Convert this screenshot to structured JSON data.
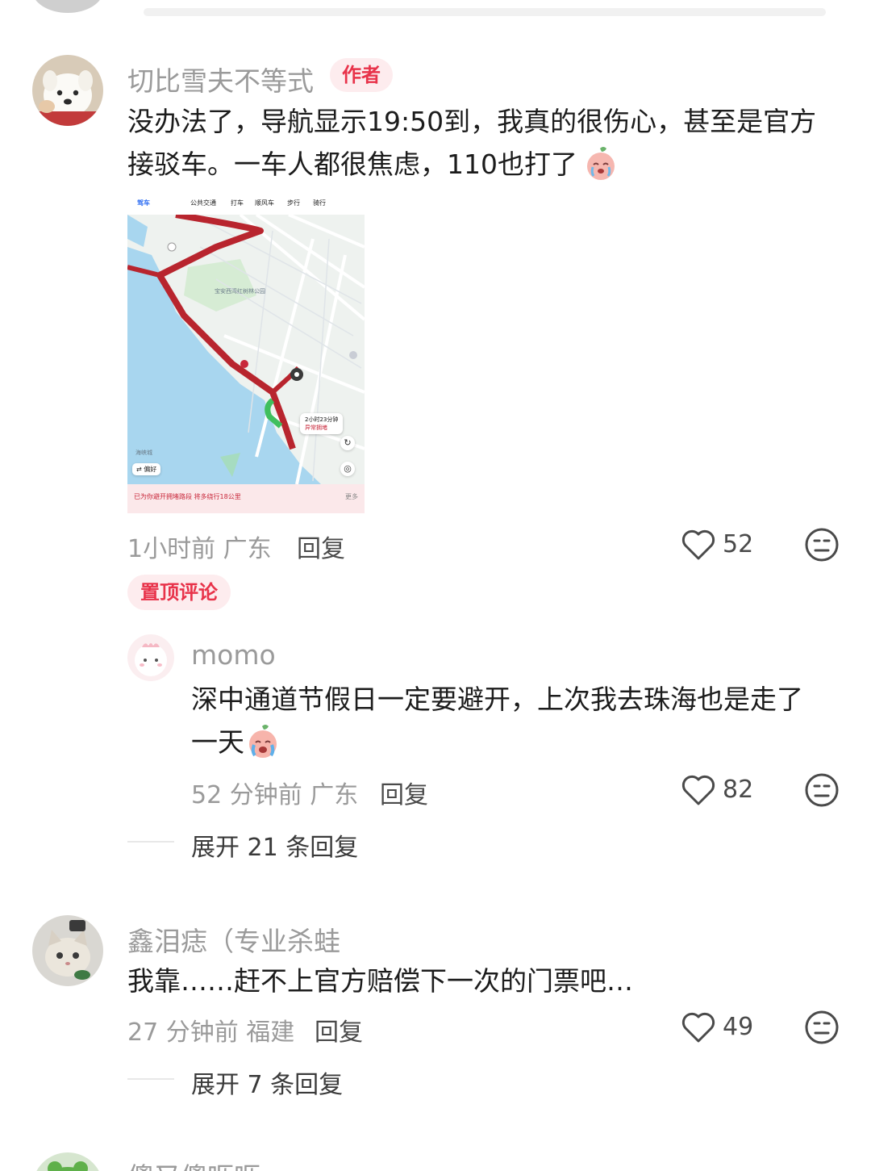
{
  "comments": [
    {
      "username": "切比雪夫不等式",
      "tag": "作者",
      "text_line1": "没办法了，导航显示19:50到，我真的很伤心，甚至是官方",
      "text_line2": "接驳车。一车人都很焦虑，110也打了",
      "time": "1小时前",
      "location": "广东",
      "reply_label": "回复",
      "likes": "52",
      "pinned_label": "置顶评论",
      "map": {
        "tabs": [
          "驾车",
          "公共交通",
          "打车",
          "顺风车",
          "步行",
          "骑行"
        ],
        "eta": "2小时23分钟",
        "eta_sub": "异常拥堵",
        "footer_warn": "已为你避开拥堵路段 将多绕行18公里",
        "footer_more": "更多",
        "pref_label": "偏好",
        "labels": [
          "宝安西湾红树林公园",
          "海峡城"
        ]
      }
    },
    {
      "username": "momo",
      "text_line1": "深中通道节假日一定要避开，上次我去珠海也是走了",
      "text_line2": "一天",
      "time": "52 分钟前",
      "location": "广东",
      "reply_label": "回复",
      "likes": "82",
      "expand_label": "展开 21 条回复"
    },
    {
      "username": "鑫泪痣（专业杀蛙",
      "text": "我靠……赶不上官方赔偿下一次的门票吧…",
      "time": "27 分钟前",
      "location": "福建",
      "reply_label": "回复",
      "likes": "49",
      "expand_label": "展开 7 条回复"
    },
    {
      "username": "傻又傻呖呖"
    }
  ],
  "colors": {
    "accent": "#e8334a",
    "tag_bg": "#fdecee",
    "meta_gray": "#9a9a9a",
    "route_red": "#b8252e",
    "water": "#a8d6ef"
  },
  "icons": [
    "heart-outline-icon",
    "neutral-face-icon",
    "crying-emoji-icon"
  ]
}
